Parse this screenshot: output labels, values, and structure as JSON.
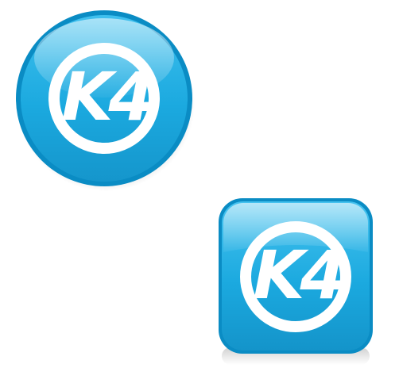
{
  "icons": [
    {
      "name": "k4-round-icon",
      "shape": "circle",
      "logo_text": "K4"
    },
    {
      "name": "k4-square-icon",
      "shape": "rounded-square",
      "logo_text": "K4"
    }
  ],
  "colors": {
    "brand_blue": "#1BA9DF",
    "highlight_blue": "#8FDBF7",
    "rim_blue": "#0A8CC4",
    "logo": "#FFFFFF"
  }
}
